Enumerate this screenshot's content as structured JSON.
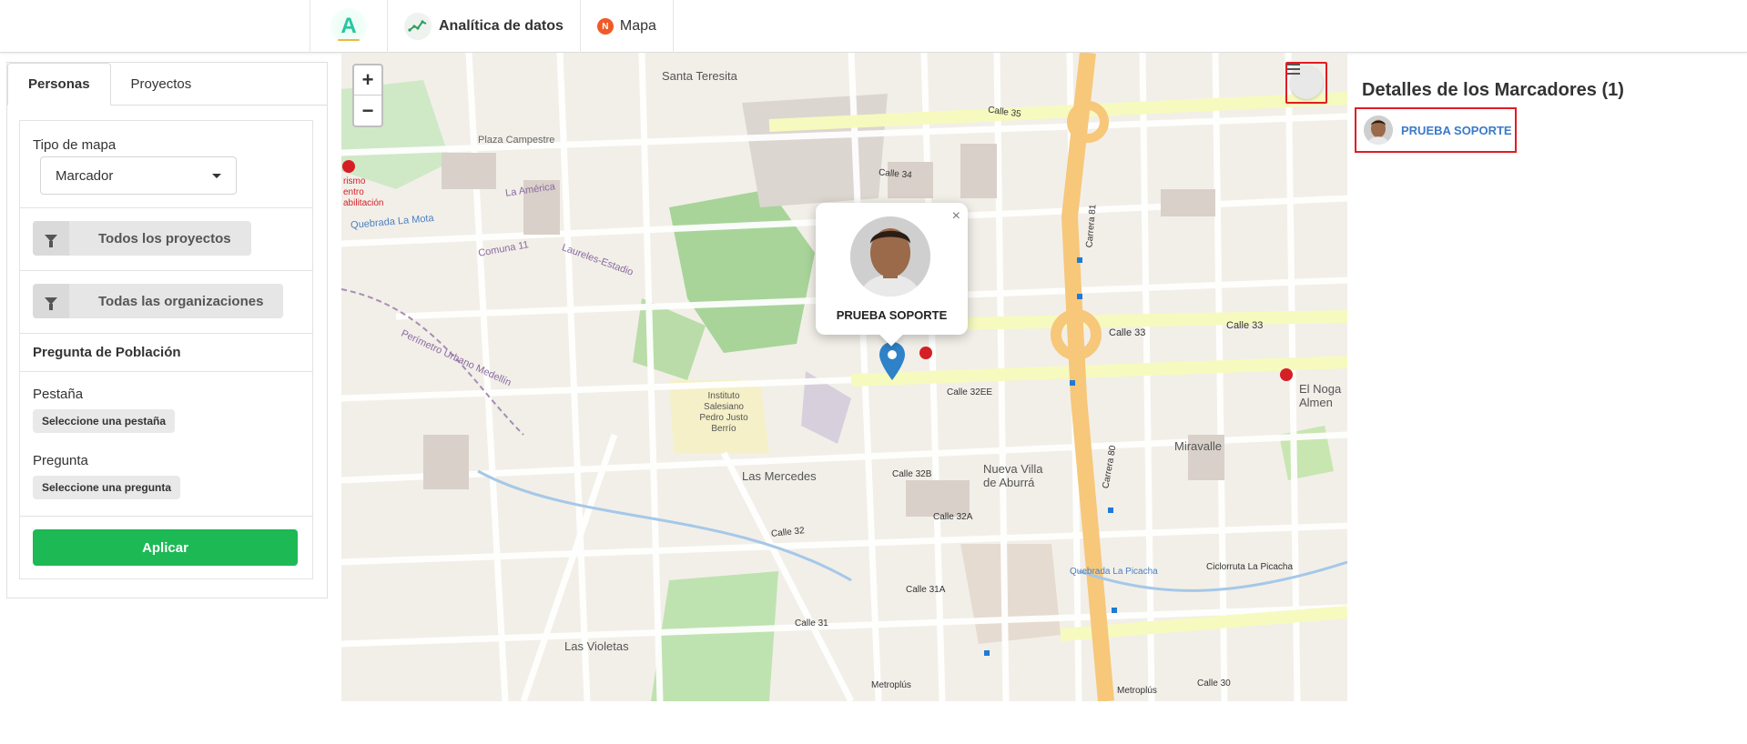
{
  "nav": {
    "logo_letter": "A",
    "analytics_label": "Analítica de datos",
    "map_badge": "N",
    "map_label": "Mapa"
  },
  "tabs": [
    {
      "label": "Personas",
      "active": true
    },
    {
      "label": "Proyectos",
      "active": false
    }
  ],
  "filters": {
    "map_type_label": "Tipo de mapa",
    "map_type_value": "Marcador",
    "projects_button": "Todos los proyectos",
    "orgs_button": "Todas las organizaciones",
    "population_title": "Pregunta de Población",
    "tab_label": "Pestaña",
    "tab_chip": "Seleccione una pestaña",
    "question_label": "Pregunta",
    "question_chip": "Seleccione una pregunta",
    "apply_button": "Aplicar"
  },
  "map": {
    "zoom_in": "+",
    "zoom_out": "−",
    "popup_name": "PRUEBA SOPORTE",
    "popup_close": "×",
    "street_labels": {
      "santa_teresita": "Santa Teresita",
      "plaza_campestre": "Plaza Campestre",
      "comuna_11": "Comuna 11",
      "la_america": "La América",
      "laureles_estadio": "Laureles-Estadio",
      "quebrada_la_mota": "Quebrada La Mota",
      "perimetro": "Perímetro Urbano Medellín",
      "instituto_1": "Instituto",
      "instituto_2": "Salesiano",
      "instituto_3": "Pedro Justo",
      "instituto_4": "Berrío",
      "las_mercedes": "Las Mercedes",
      "las_violetas": "Las Violetas",
      "nueva_villa_1": "Nueva Villa",
      "nueva_villa_2": "de Aburrá",
      "miravalle": "Miravalle",
      "el_nogal_1": "El Noga",
      "el_nogal_2": "Almen",
      "calle_33": "Calle 33",
      "calle_33b": "Calle 33",
      "calle_34": "Calle 34",
      "calle_35": "Calle 35",
      "calle_32ee": "Calle 32EE",
      "calle_30": "Calle 30",
      "carrera_80": "Carrera 80",
      "carrera_81": "Carrera 81",
      "cicloruta": "Ciclorruta La Picacha",
      "quebrada_picacha": "Quebrada La Picacha",
      "turismo_1": "rismo",
      "turismo_2": "entro",
      "turismo_3": "abilitación",
      "metroplus_1": "Metroplús",
      "metroplus_2": "Metroplús",
      "calle_32": "Calle 32",
      "calle_31": "Calle 31",
      "calle_31a": "Calle 31A",
      "calle_32a": "Calle 32A",
      "calle_32b": "Calle 32B"
    }
  },
  "details": {
    "title": "Detalles de los Marcadores (1)",
    "items": [
      {
        "name": "PRUEBA SOPORTE"
      }
    ]
  },
  "colors": {
    "accent_green": "#1db954",
    "highlight_red": "#e31b23",
    "link_blue": "#3a7bc8",
    "major_road": "#f7c77a",
    "secondary_road": "#f6fabe",
    "park": "#c8e6b0"
  }
}
